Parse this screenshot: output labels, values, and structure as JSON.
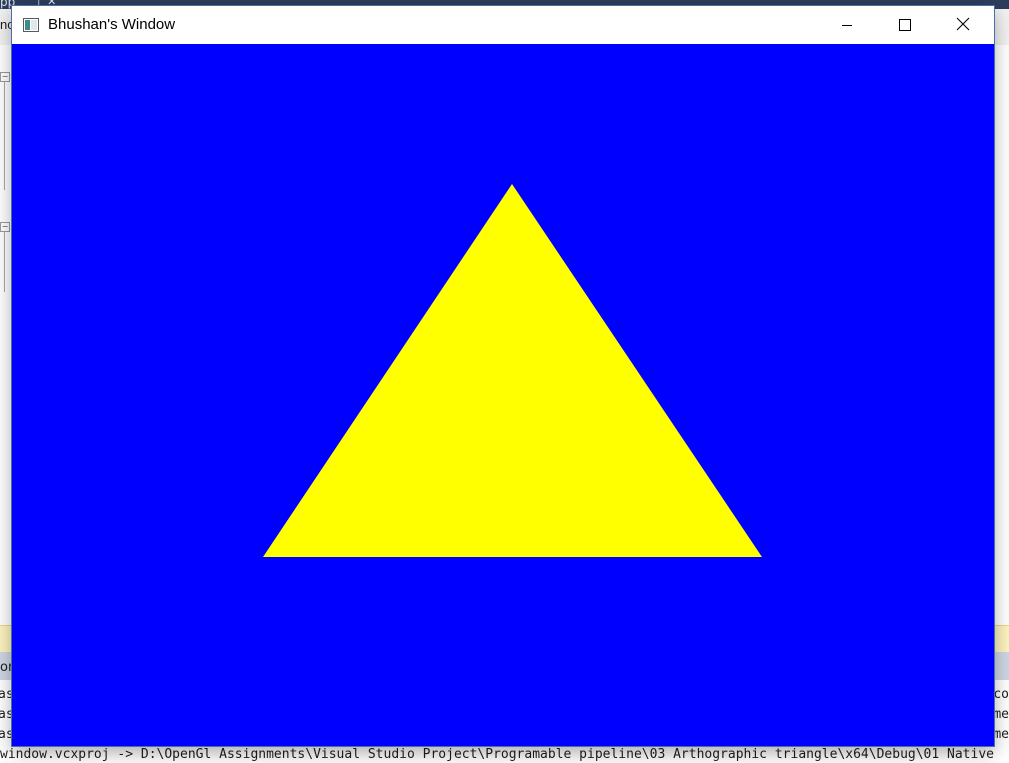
{
  "window": {
    "title": "Bhushan's Window",
    "background_color": "#0000ff",
    "icons": {
      "app": "app-window-icon",
      "minimize": "minimize-icon",
      "maximize": "maximize-icon",
      "close": "close-icon"
    }
  },
  "scene": {
    "shape": "triangle",
    "fill_color": "#ffff00"
  },
  "ide": {
    "topbar_text": "pp",
    "tab_fragment": "nc",
    "output_header_fragment": "om",
    "output_left_fragments": [
      "as",
      "as",
      "as"
    ],
    "output_right_fragments": [
      "co",
      "me",
      "me"
    ],
    "output_bottom_line": "window.vcxproj -> D:\\OpenGl Assignments\\Visual Studio Project\\Programable pipeline\\03 Arthographic triangle\\x64\\Debug\\01 Native"
  }
}
